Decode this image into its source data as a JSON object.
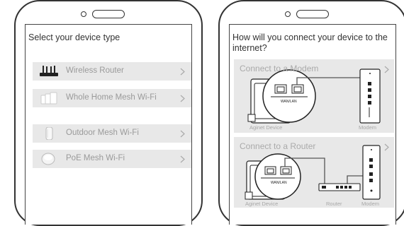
{
  "left_screen": {
    "heading": "Select your device type",
    "devices": [
      {
        "label": "Wireless Router",
        "icon": "router-icon"
      },
      {
        "label": "Whole Home Mesh Wi-Fi",
        "icon": "mesh-units-icon"
      },
      {
        "label": "Outdoor Mesh Wi-Fi",
        "icon": "outdoor-mesh-icon"
      },
      {
        "label": "PoE Mesh Wi-Fi",
        "icon": "poe-mesh-icon"
      }
    ]
  },
  "right_screen": {
    "heading": "How will you connect your device to the internet?",
    "options": [
      {
        "title": "Connect to a Modem",
        "captions": [
          "Aginet Device",
          "Modem"
        ],
        "port_label": "WAN/LAN"
      },
      {
        "title": "Connect to a Router",
        "captions": [
          "Aginet Device",
          "Router",
          "Modem"
        ],
        "port_label": "WAN/LAN"
      }
    ]
  },
  "colors": {
    "row_background": "#e8e8e8",
    "muted_text": "#9a9a9a",
    "outline": "#333333"
  }
}
